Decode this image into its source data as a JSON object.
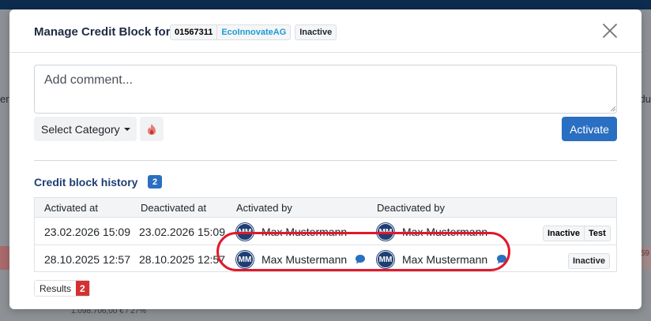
{
  "background": {
    "left_edge_text": "er",
    "right_edge_text": "du",
    "bottom_text": "1.098.706,00 € / 27%",
    "right_number": "59"
  },
  "modal": {
    "title": "Manage Credit Block for",
    "customer_id": "01567311",
    "customer_name": "EcoInnovateAG",
    "status": "Inactive",
    "close_icon": "close-icon"
  },
  "comment": {
    "placeholder": "Add comment..."
  },
  "category": {
    "label": "Select Category"
  },
  "activate_label": "Activate",
  "history": {
    "title": "Credit block history",
    "count": "2",
    "columns": [
      "Activated at",
      "Deactivated at",
      "Activated by",
      "Deactivated by"
    ],
    "rows": [
      {
        "activated_at": "23.02.2026 15:09",
        "deactivated_at": "23.02.2026 15:09",
        "activated_by": {
          "initials": "MM",
          "name": "Max Mustermann"
        },
        "deactivated_by": {
          "initials": "MM",
          "name": "Max Mustermann"
        },
        "badges": [
          "Inactive",
          "Test"
        ]
      },
      {
        "activated_at": "28.10.2025 12:57",
        "deactivated_at": "28.10.2025 12:57",
        "activated_by": {
          "initials": "MM",
          "name": "Max Mustermann"
        },
        "deactivated_by": {
          "initials": "MM",
          "name": "Max Mustermann"
        },
        "badges": [
          "Inactive"
        ]
      }
    ]
  },
  "results": {
    "label": "Results",
    "count": "2"
  },
  "colors": {
    "primary": "#2a6fc1",
    "navy": "#1f3f73",
    "link": "#1c9ad6",
    "danger": "#d63031",
    "highlight": "#e0192b"
  }
}
